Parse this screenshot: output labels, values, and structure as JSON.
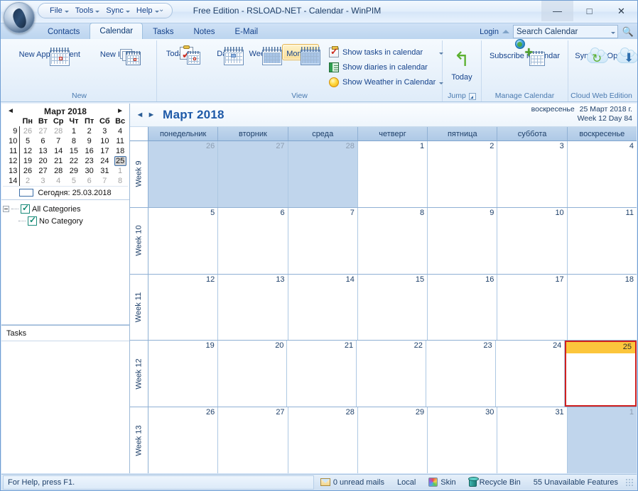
{
  "window": {
    "title": "Free Edition - RSLOAD-NET - Calendar - WinPIM",
    "minimize": "—",
    "maximize": "□",
    "close": "✕"
  },
  "quick_access": {
    "items": [
      {
        "label": "File"
      },
      {
        "label": "Tools"
      },
      {
        "label": "Sync"
      },
      {
        "label": "Help"
      }
    ],
    "more": "⌄"
  },
  "ribbon_tabs": [
    {
      "label": "Contacts",
      "active": false
    },
    {
      "label": "Calendar",
      "active": true
    },
    {
      "label": "Tasks",
      "active": false
    },
    {
      "label": "Notes",
      "active": false
    },
    {
      "label": "E-Mail",
      "active": false
    }
  ],
  "tabstrip_right": {
    "login": "Login",
    "search_value": "Search Calendar"
  },
  "ribbon": {
    "groups": [
      {
        "name": "New",
        "label": "New",
        "buttons": [
          {
            "label": "New Appointment",
            "dropdown": false
          },
          {
            "label": "New Item",
            "dropdown": true
          }
        ]
      },
      {
        "name": "View",
        "label": "View",
        "buttons": [
          {
            "label": "Today",
            "dropdown": true
          },
          {
            "label": "Day",
            "dropdown": false
          },
          {
            "label": "Week",
            "dropdown": true
          },
          {
            "label": "Month",
            "dropdown": true,
            "selected": true
          }
        ],
        "checkrows": [
          {
            "label": "Show tasks in calendar",
            "dropdown": true
          },
          {
            "label": "Show diaries in calendar",
            "dropdown": false
          },
          {
            "label": "Show Weather in Calendar",
            "dropdown": true
          }
        ]
      },
      {
        "name": "Jump",
        "label": "Jump",
        "buttons": [
          {
            "label": "Today",
            "dropdown": false
          }
        ]
      },
      {
        "name": "Manage Calendar",
        "label": "Manage Calendar",
        "buttons": [
          {
            "label": "Subscribe iCalendar",
            "dropdown": false
          }
        ]
      },
      {
        "name": "Cloud Web Edition",
        "label": "Cloud Web Edition",
        "buttons": [
          {
            "label": "Sync",
            "dropdown": true
          },
          {
            "label": "Open",
            "dropdown": false
          }
        ]
      }
    ]
  },
  "sidebar": {
    "minicalendar": {
      "title": "Март 2018",
      "prev": "◄",
      "next": "►",
      "weekday_headers": [
        "Пн",
        "Вт",
        "Ср",
        "Чт",
        "Пт",
        "Сб",
        "Вс"
      ],
      "rows": [
        {
          "week": "9",
          "days": [
            {
              "d": "26",
              "out": true
            },
            {
              "d": "27",
              "out": true
            },
            {
              "d": "28",
              "out": true
            },
            {
              "d": "1"
            },
            {
              "d": "2"
            },
            {
              "d": "3"
            },
            {
              "d": "4"
            }
          ]
        },
        {
          "week": "10",
          "days": [
            {
              "d": "5"
            },
            {
              "d": "6"
            },
            {
              "d": "7"
            },
            {
              "d": "8"
            },
            {
              "d": "9"
            },
            {
              "d": "10"
            },
            {
              "d": "11"
            }
          ]
        },
        {
          "week": "11",
          "days": [
            {
              "d": "12"
            },
            {
              "d": "13"
            },
            {
              "d": "14"
            },
            {
              "d": "15"
            },
            {
              "d": "16"
            },
            {
              "d": "17"
            },
            {
              "d": "18"
            }
          ]
        },
        {
          "week": "12",
          "days": [
            {
              "d": "19"
            },
            {
              "d": "20"
            },
            {
              "d": "21"
            },
            {
              "d": "22"
            },
            {
              "d": "23"
            },
            {
              "d": "24"
            },
            {
              "d": "25",
              "today": true
            }
          ]
        },
        {
          "week": "13",
          "days": [
            {
              "d": "26"
            },
            {
              "d": "27"
            },
            {
              "d": "28"
            },
            {
              "d": "29"
            },
            {
              "d": "30"
            },
            {
              "d": "31"
            },
            {
              "d": "1",
              "out": true
            }
          ]
        },
        {
          "week": "14",
          "days": [
            {
              "d": "2",
              "out": true
            },
            {
              "d": "3",
              "out": true
            },
            {
              "d": "4",
              "out": true
            },
            {
              "d": "5",
              "out": true
            },
            {
              "d": "6",
              "out": true
            },
            {
              "d": "7",
              "out": true
            },
            {
              "d": "8",
              "out": true
            }
          ]
        }
      ],
      "footer": "Сегодня: 25.03.2018"
    },
    "categories": [
      {
        "label": "All Categories",
        "checked": true,
        "level": 0
      },
      {
        "label": "No Category",
        "checked": true,
        "level": 1
      }
    ],
    "tasks_header": "Tasks"
  },
  "calendar": {
    "prev": "◄",
    "next": "►",
    "title": "Март 2018",
    "info_dow": "воскресенье",
    "info_date": "25 Март 2018 г.",
    "info_week_day": "Week 12 Day 84",
    "weekday_headers": [
      "понедельник",
      "вторник",
      "среда",
      "четверг",
      "пятница",
      "суббота",
      "воскресенье"
    ],
    "weeks": [
      {
        "label": "Week 9",
        "days": [
          {
            "n": "26",
            "other": true
          },
          {
            "n": "27",
            "other": true
          },
          {
            "n": "28",
            "other": true
          },
          {
            "n": "1"
          },
          {
            "n": "2"
          },
          {
            "n": "3"
          },
          {
            "n": "4"
          }
        ]
      },
      {
        "label": "Week 10",
        "days": [
          {
            "n": "5"
          },
          {
            "n": "6"
          },
          {
            "n": "7"
          },
          {
            "n": "8"
          },
          {
            "n": "9"
          },
          {
            "n": "10"
          },
          {
            "n": "11"
          }
        ]
      },
      {
        "label": "Week 11",
        "days": [
          {
            "n": "12"
          },
          {
            "n": "13"
          },
          {
            "n": "14"
          },
          {
            "n": "15"
          },
          {
            "n": "16"
          },
          {
            "n": "17"
          },
          {
            "n": "18"
          }
        ]
      },
      {
        "label": "Week 12",
        "days": [
          {
            "n": "19"
          },
          {
            "n": "20"
          },
          {
            "n": "21"
          },
          {
            "n": "22"
          },
          {
            "n": "23"
          },
          {
            "n": "24"
          },
          {
            "n": "25",
            "selected": true
          }
        ]
      },
      {
        "label": "Week 13",
        "days": [
          {
            "n": "26"
          },
          {
            "n": "27"
          },
          {
            "n": "28"
          },
          {
            "n": "29"
          },
          {
            "n": "30"
          },
          {
            "n": "31"
          },
          {
            "n": "1",
            "other": true
          }
        ]
      }
    ]
  },
  "statusbar": {
    "help": "For Help, press F1.",
    "items": [
      {
        "label": "0 unread mails",
        "icon": "mail-icon"
      },
      {
        "label": "Local",
        "icon": null
      },
      {
        "label": "Skin",
        "icon": "skin-icon"
      },
      {
        "label": "Recycle Bin",
        "icon": "recycle-bin-icon"
      },
      {
        "label": "55 Unavailable Features",
        "icon": null
      }
    ]
  },
  "colors": {
    "accent": "#15428b",
    "selected_day": "#fcc63c",
    "selected_border": "#cf2020",
    "other_month": "#c0d5ec"
  }
}
